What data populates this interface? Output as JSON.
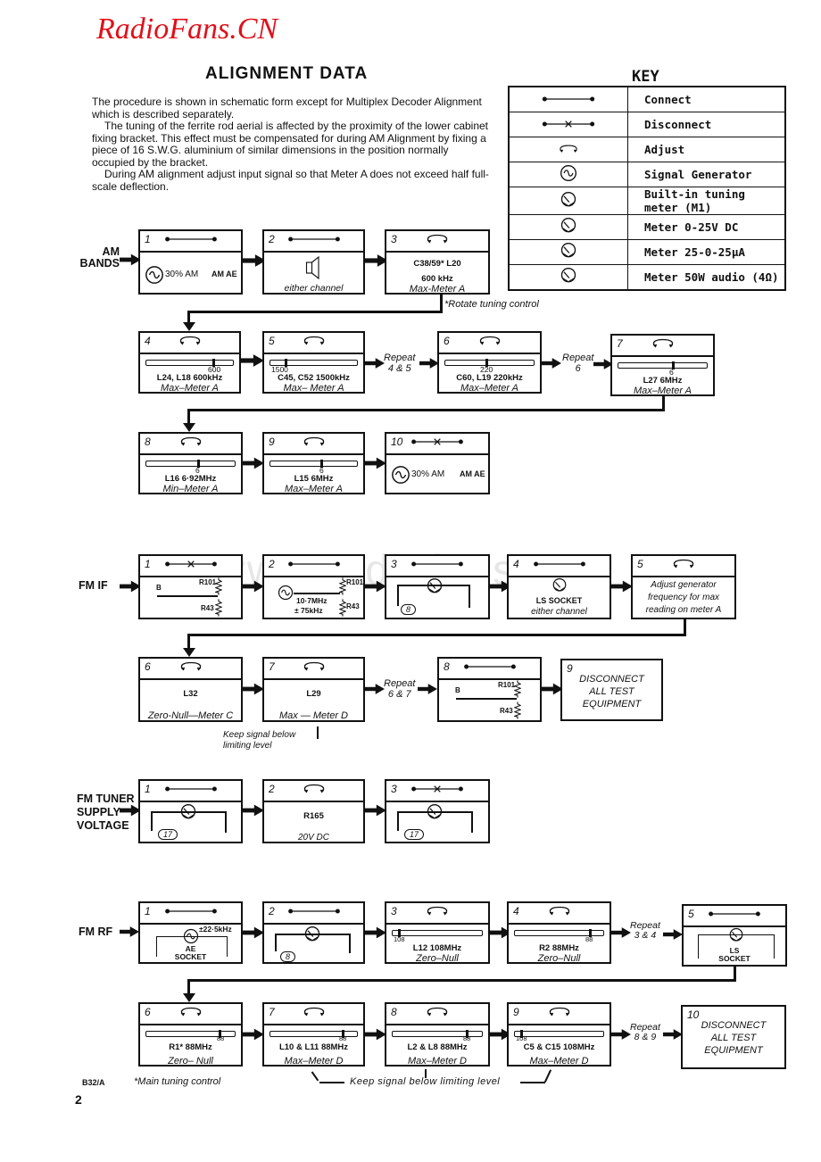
{
  "watermark": {
    "brand": "RadioFans.CN",
    "site": "www.radiofans.cn"
  },
  "page_title": "ALIGNMENT DATA",
  "intro": [
    "The procedure is shown in schematic form except for Multiplex Decoder Alignment which is described separately.",
    "The tuning of the ferrite rod aerial is affected by the proximity of the lower cabinet fixing bracket. This effect must be compensated for during AM Alignment by fixing a piece of 16 S.W.G. aluminium of similar dimensions in the position normally occupied by the bracket.",
    "During AM alignment adjust input signal so that Meter A does not exceed half full-scale deflection."
  ],
  "key": {
    "title": "KEY",
    "items": [
      {
        "icon": "connect-icon",
        "label": "Connect"
      },
      {
        "icon": "disconnect-icon",
        "label": "Disconnect"
      },
      {
        "icon": "adjust-icon",
        "label": "Adjust"
      },
      {
        "icon": "signal-generator-icon",
        "label": "Signal Generator"
      },
      {
        "icon": "meter-a-icon",
        "label": "Built-in tuning meter (M1)"
      },
      {
        "icon": "meter-b-icon",
        "label": "Meter  0-25V DC"
      },
      {
        "icon": "meter-c-icon",
        "label": "Meter  25-0-25µA"
      },
      {
        "icon": "meter-d-icon",
        "label": "Meter  50W audio (4Ω)"
      }
    ]
  },
  "am": {
    "label": "AM\nBANDS",
    "footnote": "*Rotate tuning control",
    "steps": [
      {
        "num": "1",
        "action": "connect",
        "gen": "30% AM",
        "target": "AM AE"
      },
      {
        "num": "2",
        "action": "connect",
        "caption": "either channel"
      },
      {
        "num": "3",
        "action": "adjust",
        "line1": "C38/59*   L20",
        "line2": "600 kHz",
        "caption": "Max-Meter A"
      },
      {
        "num": "4",
        "action": "adjust",
        "scale": "600",
        "line1": "L24, L18   600kHz",
        "caption": "Max–Meter A"
      },
      {
        "num": "5",
        "action": "adjust",
        "scale": "1500",
        "line1": "C45, C52  1500kHz",
        "caption": "Max– Meter A"
      },
      {
        "num": "6",
        "action": "adjust",
        "scale": "220",
        "line1": "C60, L19  220kHz",
        "caption": "Max–Meter A"
      },
      {
        "num": "7",
        "action": "adjust",
        "scale": "6",
        "line1": "L27    6MHz",
        "caption": "Max–Meter A"
      },
      {
        "num": "8",
        "action": "adjust",
        "scale": "6",
        "line1": "L16   6·92MHz",
        "caption": "Min–Meter A"
      },
      {
        "num": "9",
        "action": "adjust",
        "scale": "6",
        "line1": "L15   6MHz",
        "caption": "Max–Meter A"
      },
      {
        "num": "10",
        "action": "disconnect",
        "gen": "30% AM",
        "target": "AM AE"
      }
    ],
    "repeat_a": "Repeat\n4 & 5",
    "repeat_b": "Repeat\n6"
  },
  "fmif": {
    "label": "FM IF",
    "steps": [
      {
        "num": "1",
        "action": "disconnect",
        "b": "B",
        "r1": "R101",
        "r2": "R43"
      },
      {
        "num": "2",
        "action": "connect",
        "freq1": "10·7MHz",
        "freq2": "± 75kHz",
        "r1": "R101",
        "r2": "R43"
      },
      {
        "num": "3",
        "action": "connect",
        "meter": "C",
        "pin": "8"
      },
      {
        "num": "4",
        "action": "connect",
        "meter": "D",
        "socket": "LS SOCKET",
        "caption": "either channel"
      },
      {
        "num": "5",
        "action": "adjust",
        "text": "Adjust generator frequency for max reading on meter A"
      },
      {
        "num": "6",
        "action": "adjust",
        "line1": "L32",
        "caption": "Zero-Null—Meter C"
      },
      {
        "num": "7",
        "action": "adjust",
        "line1": "L29",
        "caption": "Max — Meter D"
      },
      {
        "num": "8",
        "action": "connect",
        "b": "B",
        "r1": "R101",
        "r2": "R43"
      },
      {
        "num": "9",
        "text": "DISCONNECT\nALL TEST\nEQUIPMENT"
      }
    ],
    "repeat": "Repeat\n6 & 7",
    "note": "Keep signal below\nlimiting level"
  },
  "fmtuner": {
    "label": "FM TUNER\nSUPPLY\nVOLTAGE",
    "steps": [
      {
        "num": "1",
        "action": "connect",
        "meter": "B",
        "pin": "17"
      },
      {
        "num": "2",
        "action": "adjust",
        "line1": "R165",
        "caption": "20V DC"
      },
      {
        "num": "3",
        "action": "disconnect",
        "meter": "B",
        "pin": "17"
      }
    ]
  },
  "fmrf": {
    "label": "FM RF",
    "steps": [
      {
        "num": "1",
        "action": "connect",
        "dev": "±22·5kHz",
        "socket": "AE\nSOCKET"
      },
      {
        "num": "2",
        "action": "connect",
        "meter": "C",
        "pin": "8"
      },
      {
        "num": "3",
        "action": "adjust",
        "scale": "108",
        "line1": "L12   108MHz",
        "caption": "Zero–Null"
      },
      {
        "num": "4",
        "action": "adjust",
        "scale": "88",
        "line1": "R2    88MHz",
        "caption": "Zero–Null"
      },
      {
        "num": "5",
        "action": "connect",
        "meter": "D",
        "socket": "LS\nSOCKET"
      },
      {
        "num": "6",
        "action": "adjust",
        "scale": "88",
        "line1": "R1*      88MHz",
        "caption": "Zero– Null"
      },
      {
        "num": "7",
        "action": "adjust",
        "scale": "88",
        "line1": "L10 & L11  88MHz",
        "caption": "Max–Meter D"
      },
      {
        "num": "8",
        "action": "adjust",
        "scale": "88",
        "line1": "L2 & L8    88MHz",
        "caption": "Max–Meter D"
      },
      {
        "num": "9",
        "action": "adjust",
        "scale": "108",
        "line1": "C5 & C15  108MHz",
        "caption": "Max–Meter D"
      },
      {
        "num": "10",
        "text": "DISCONNECT\nALL TEST\nEQUIPMENT"
      }
    ],
    "repeat_a": "Repeat\n3 & 4",
    "repeat_b": "Repeat\n8 & 9",
    "note": "Keep signal below limiting level"
  },
  "footer": {
    "code": "B32/A",
    "footnote": "*Main tuning control",
    "page": "2"
  }
}
